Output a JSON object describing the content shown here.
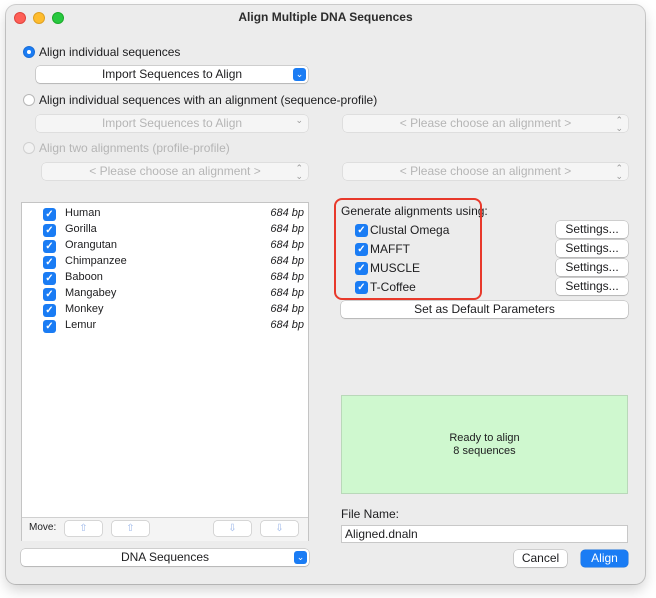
{
  "window": {
    "title": "Align Multiple DNA Sequences"
  },
  "modes": {
    "option1": {
      "label": "Align individual sequences",
      "selected": true
    },
    "option2": {
      "label": "Align individual sequences with an alignment (sequence-profile)",
      "selected": false
    },
    "option3": {
      "label": "Align two alignments (profile-profile)",
      "selected": false,
      "disabled": true
    }
  },
  "popups": {
    "import1": "Import Sequences to Align",
    "import2": "Import Sequences to Align",
    "choose1": "< Please choose an alignment >",
    "choose2": "< Please choose an alignment >",
    "choose3": "< Please choose an alignment >",
    "sequence_type": "DNA Sequences"
  },
  "sequences": [
    {
      "name": "Human",
      "length": "684 bp",
      "checked": true
    },
    {
      "name": "Gorilla",
      "length": "684 bp",
      "checked": true
    },
    {
      "name": "Orangutan",
      "length": "684 bp",
      "checked": true
    },
    {
      "name": "Chimpanzee",
      "length": "684 bp",
      "checked": true
    },
    {
      "name": "Baboon",
      "length": "684 bp",
      "checked": true
    },
    {
      "name": "Mangabey",
      "length": "684 bp",
      "checked": true
    },
    {
      "name": "Monkey",
      "length": "684 bp",
      "checked": true
    },
    {
      "name": "Lemur",
      "length": "684 bp",
      "checked": true
    }
  ],
  "move": {
    "label": "Move:"
  },
  "generate": {
    "heading": "Generate alignments using:",
    "methods": [
      {
        "name": "Clustal Omega",
        "checked": true,
        "settings": "Settings..."
      },
      {
        "name": "MAFFT",
        "checked": true,
        "settings": "Settings..."
      },
      {
        "name": "MUSCLE",
        "checked": true,
        "settings": "Settings..."
      },
      {
        "name": "T-Coffee",
        "checked": true,
        "settings": "Settings..."
      }
    ],
    "default_button": "Set as Default Parameters"
  },
  "status": {
    "line1": "Ready to align",
    "line2": "8 sequences"
  },
  "file": {
    "label": "File Name:",
    "value": "Aligned.dnaln"
  },
  "buttons": {
    "cancel": "Cancel",
    "align": "Align"
  },
  "colors": {
    "accent": "#1a7cf4",
    "status_bg": "#cff8cf",
    "highlight": "#e8392b"
  }
}
